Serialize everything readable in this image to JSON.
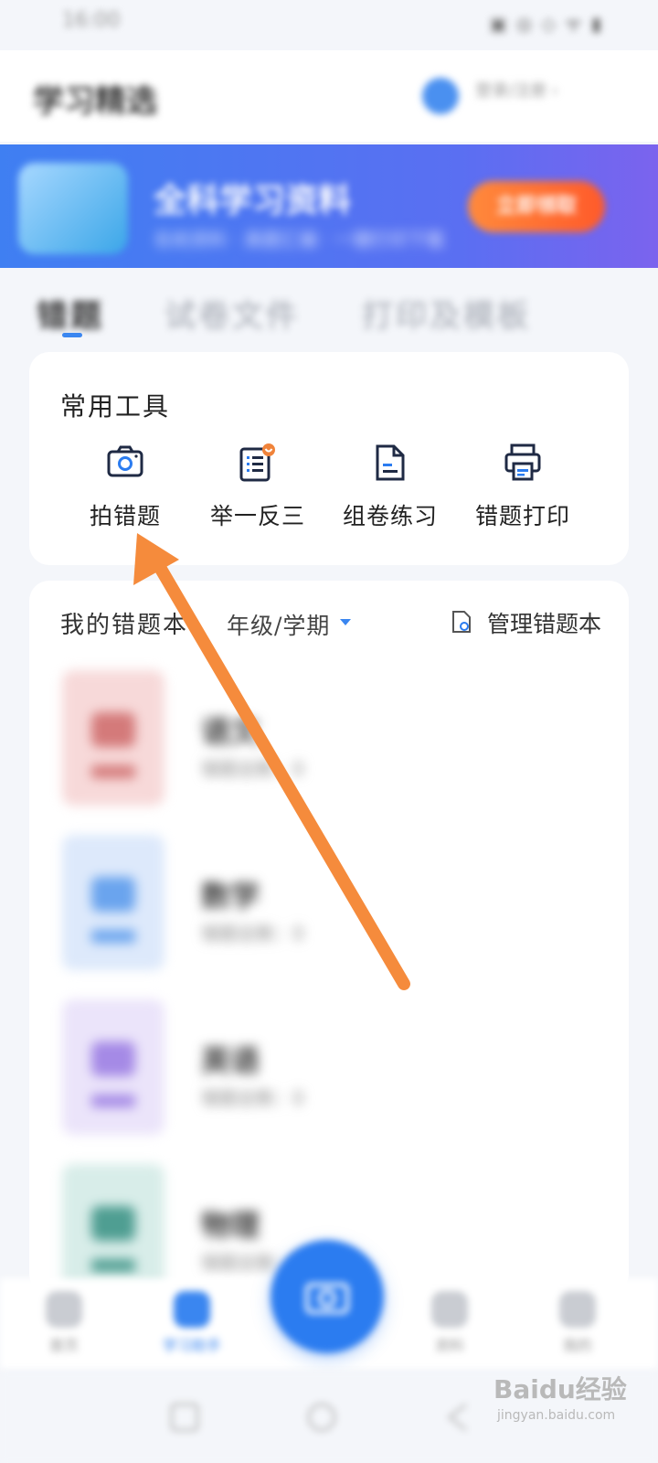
{
  "status_bar": {
    "time": "16:00",
    "icons": "▣ ◎ ◇ ᯤ ▮"
  },
  "header": {
    "title": "学习精选",
    "user_text": "登录/注册 ›"
  },
  "banner": {
    "title": "全科学习资料",
    "subtitle": "名校资料 · 真题汇编 · 一键打印下载",
    "cta": "立即领取"
  },
  "tabs": [
    {
      "label": "错题",
      "active": true
    },
    {
      "label": "试卷文件",
      "active": false
    },
    {
      "label": "打印及模板",
      "active": false
    }
  ],
  "tools": {
    "title": "常用工具",
    "items": [
      {
        "label": "拍错题",
        "icon": "camera-icon"
      },
      {
        "label": "举一反三",
        "icon": "list-doc-icon"
      },
      {
        "label": "组卷练习",
        "icon": "document-icon"
      },
      {
        "label": "错题打印",
        "icon": "printer-icon"
      }
    ]
  },
  "mistake_book": {
    "heading": "我的错题本",
    "filter": "年级/学期",
    "manage": "管理错题本",
    "subjects": [
      {
        "name": "语文",
        "count": "错题总数：0",
        "color": "#f2c6c6",
        "mark": "#d47a7a"
      },
      {
        "name": "数学",
        "count": "错题总数：0",
        "color": "#cfe2fb",
        "mark": "#6aa4ee"
      },
      {
        "name": "英语",
        "count": "错题总数：0",
        "color": "#e1d8f7",
        "mark": "#a58ae6"
      },
      {
        "name": "物理",
        "count": "错题总数：0",
        "color": "#cfe8e4",
        "mark": "#4f9e92"
      }
    ]
  },
  "bottom_nav": {
    "items": [
      {
        "label": "首页"
      },
      {
        "label": "学习助手"
      },
      {
        "label": "资料"
      },
      {
        "label": "我的"
      }
    ]
  },
  "watermark": {
    "logo": "Baidu经验",
    "sub": "jingyan.baidu.com"
  },
  "colors": {
    "accent": "#3a86f0",
    "arrow": "#f58b3c"
  }
}
